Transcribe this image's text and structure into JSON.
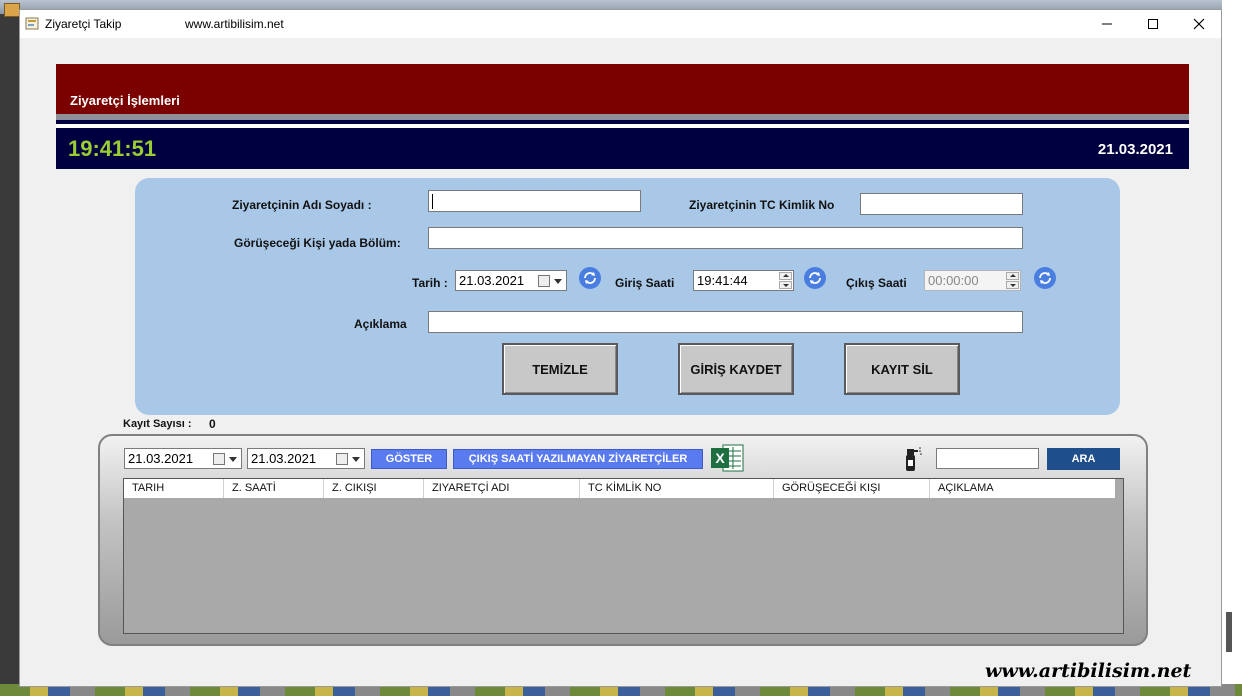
{
  "window": {
    "title": "Ziyaretçi Takip",
    "subtitle": "www.artibilisim.net"
  },
  "header": {
    "title": "Ziyaretçi İşlemleri",
    "clock": "19:41:51",
    "date": "21.03.2021"
  },
  "form": {
    "name_label": "Ziyaretçinin Adı Soyadı :",
    "name_value": "",
    "tc_label": "Ziyaretçinin TC Kimlik No",
    "tc_value": "",
    "meet_label": "Görüşeceği Kişi  yada Bölüm:",
    "meet_value": "",
    "date_label": "Tarih :",
    "date_value": "21.03.2021",
    "entry_label": "Giriş Saati",
    "entry_value": "19:41:44",
    "exit_label": "Çıkış Saati",
    "exit_value": "00:00:00",
    "desc_label": "Açıklama",
    "desc_value": "",
    "btn_clear": "TEMİZLE",
    "btn_save": "GİRİŞ KAYDET",
    "btn_delete": "KAYIT SİL"
  },
  "records": {
    "count_label": "Kayıt Sayısı :",
    "count_value": "0"
  },
  "list": {
    "date_from": "21.03.2021",
    "date_to": "21.03.2021",
    "show_btn": "GÖSTER",
    "no_exit_btn": "ÇIKIŞ SAATİ YAZILMAYAN ZİYARETÇİLER",
    "excel_letter": "X",
    "search_value": "",
    "search_btn": "ARA",
    "columns": [
      "TARIH",
      "Z. SAATİ",
      "Z. CIKIŞI",
      "ZIYARETÇİ ADI",
      "TC KİMLİK NO",
      "GÖRÜŞECEĞİ KIŞI",
      "AÇIKLAMA"
    ]
  },
  "watermark": "www.artibilisim.net",
  "icons": {
    "app": "app-icon",
    "refresh": "refresh-icon",
    "excel": "excel-icon",
    "clean": "spray-bottle-icon"
  },
  "colors": {
    "header_red": "#7b0000",
    "clock_bar": "#000040",
    "clock_green": "#9acd32",
    "panel_blue": "#a9c8e8",
    "button_blue": "#5a7bef"
  }
}
